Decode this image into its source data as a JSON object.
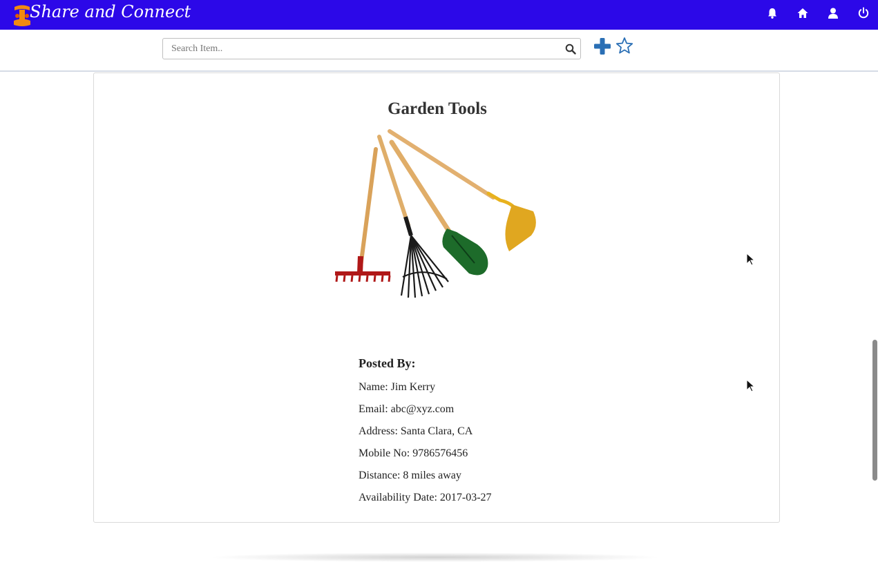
{
  "navbar": {
    "brand_title": "Share and Connect",
    "icons": [
      "bell-icon",
      "home-icon",
      "user-icon",
      "power-icon"
    ],
    "color": "#2c08e8"
  },
  "search": {
    "placeholder": "Search Item..",
    "value": "",
    "icon": "search-icon"
  },
  "actions": {
    "add_icon": "plus-icon",
    "favorite_icon": "star-outline-icon",
    "accent_color": "#2a6fb5"
  },
  "item": {
    "title": "Garden Tools",
    "image": "garden-tools-illustration"
  },
  "posted_by": {
    "heading": "Posted By:",
    "name": "Name: Jim Kerry",
    "email": "Email: abc@xyz.com",
    "address": "Address: Santa Clara, CA",
    "mobile": "Mobile No: 9786576456",
    "distance": "Distance: 8 miles away",
    "availability": "Availability Date: 2017-03-27"
  }
}
